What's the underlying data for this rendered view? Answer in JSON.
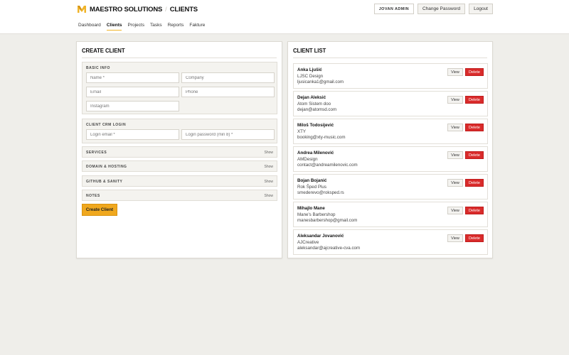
{
  "header": {
    "brand_name": "MAESTRO SOLUTIONS",
    "separator": "/",
    "page": "CLIENTS",
    "logo_icon": "m-logo-icon",
    "accent_color": "#f0b429",
    "user_label": "JOVAN ADMIN",
    "change_password": "Change Password",
    "logout": "Logout"
  },
  "nav": {
    "items": [
      "Dashboard",
      "Clients",
      "Projects",
      "Tasks",
      "Reports",
      "Fakture"
    ],
    "active": "Clients"
  },
  "create": {
    "title": "CREATE CLIENT",
    "basic_label": "BASIC INFO",
    "name_placeholder": "Name *",
    "company_placeholder": "Company",
    "email_placeholder": "Email",
    "phone_placeholder": "Phone",
    "instagram_placeholder": "Instagram",
    "crm_label": "CLIENT CRM LOGIN",
    "login_email_placeholder": "Login email *",
    "login_password_placeholder": "Login password (min 8) *",
    "sections": [
      {
        "label": "SERVICES",
        "action": "Show"
      },
      {
        "label": "DOMAIN & HOSTING",
        "action": "Show"
      },
      {
        "label": "GITHUB & SANITY",
        "action": "Show"
      },
      {
        "label": "NOTES",
        "action": "Show"
      }
    ],
    "submit": "Create Client",
    "submit_color": "#f0a81e"
  },
  "list": {
    "title": "CLIENT LIST",
    "view_label": "View",
    "delete_label": "Delete",
    "delete_color": "#d92b2b",
    "clients": [
      {
        "name": "Anka Ljušić",
        "company": "LJSC Design",
        "email": "ljusicanka1@gmail.com"
      },
      {
        "name": "Dejan Aleksić",
        "company": "Atom Sistem doo",
        "email": "dejan@atomsd.com"
      },
      {
        "name": "Miloš Todosijević",
        "company": "XTY",
        "email": "booking@xty-music.com"
      },
      {
        "name": "Andrea Milenović",
        "company": "AMDesign",
        "email": "contact@andreamilenovic.com"
      },
      {
        "name": "Bojan Bojanić",
        "company": "Rok Šped Plus",
        "email": "smederevo@roksped.rs"
      },
      {
        "name": "Mihajlo Mane",
        "company": "Mane's Barbershop",
        "email": "manesbarbershop@gmail.com"
      },
      {
        "name": "Aleksandar Jovanović",
        "company": "AJCreative",
        "email": "aleksandar@ajcreative-cva.com"
      }
    ]
  }
}
